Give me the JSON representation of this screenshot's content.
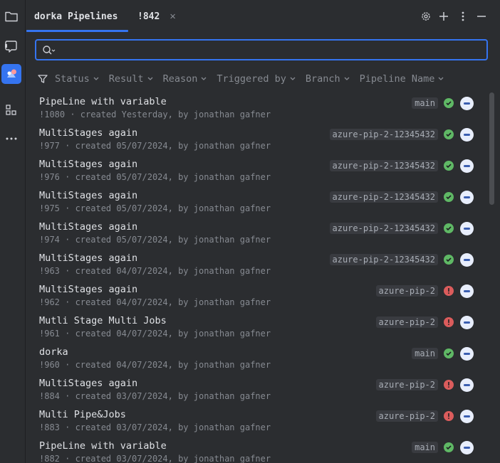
{
  "tabs": [
    {
      "label": "dorka Pipelines",
      "active": true
    },
    {
      "label": "!842",
      "active": false
    }
  ],
  "search": {
    "value": "",
    "placeholder": ""
  },
  "filters": [
    {
      "label": "Status"
    },
    {
      "label": "Result"
    },
    {
      "label": "Reason"
    },
    {
      "label": "Triggered by"
    },
    {
      "label": "Branch"
    },
    {
      "label": "Pipeline Name"
    }
  ],
  "pipelines": [
    {
      "title": "PipeLine with variable",
      "subtitle": "!1080 · created Yesterday, by jonathan gafner",
      "branch": "main",
      "status": "success"
    },
    {
      "title": "MultiStages again",
      "subtitle": "!977 · created 05/07/2024, by jonathan gafner",
      "branch": "azure-pip-2-12345432",
      "status": "success"
    },
    {
      "title": "MultiStages again",
      "subtitle": "!976 · created 05/07/2024, by jonathan gafner",
      "branch": "azure-pip-2-12345432",
      "status": "success"
    },
    {
      "title": "MultiStages again",
      "subtitle": "!975 · created 05/07/2024, by jonathan gafner",
      "branch": "azure-pip-2-12345432",
      "status": "success"
    },
    {
      "title": "MultiStages again",
      "subtitle": "!974 · created 05/07/2024, by jonathan gafner",
      "branch": "azure-pip-2-12345432",
      "status": "success"
    },
    {
      "title": "MultiStages again",
      "subtitle": "!963 · created 04/07/2024, by jonathan gafner",
      "branch": "azure-pip-2-12345432",
      "status": "success"
    },
    {
      "title": "MultiStages again",
      "subtitle": "!962 · created 04/07/2024, by jonathan gafner",
      "branch": "azure-pip-2",
      "status": "failed"
    },
    {
      "title": "Mutli Stage Multi Jobs",
      "subtitle": "!961 · created 04/07/2024, by jonathan gafner",
      "branch": "azure-pip-2",
      "status": "failed"
    },
    {
      "title": "dorka",
      "subtitle": "!960 · created 04/07/2024, by jonathan gafner",
      "branch": "main",
      "status": "success"
    },
    {
      "title": "MultiStages again",
      "subtitle": "!884 · created 03/07/2024, by jonathan gafner",
      "branch": "azure-pip-2",
      "status": "failed"
    },
    {
      "title": "Multi Pipe&Jobs",
      "subtitle": "!883 · created 03/07/2024, by jonathan gafner",
      "branch": "azure-pip-2",
      "status": "failed"
    },
    {
      "title": "PipeLine with variable",
      "subtitle": "!882 · created 03/07/2024, by jonathan gafner",
      "branch": "main",
      "status": "success"
    }
  ],
  "icons": {
    "left_bar": [
      "folder-icon",
      "pull-request-icon",
      "pipelines-icon",
      "structure-icon",
      "more-icon"
    ],
    "toolbar": [
      "gear-icon",
      "plus-icon",
      "kebab-menu-icon",
      "minimize-icon"
    ]
  },
  "colors": {
    "accent": "#3574f0",
    "success": "#5fb865",
    "failure": "#db5c5c",
    "background": "#2b2d30"
  }
}
